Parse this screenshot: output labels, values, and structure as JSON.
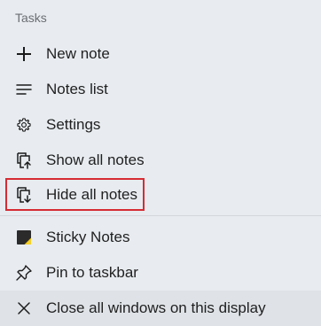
{
  "menu": {
    "section_label": "Tasks",
    "items": [
      {
        "label": "New note",
        "icon": "plus-icon"
      },
      {
        "label": "Notes list",
        "icon": "list-icon"
      },
      {
        "label": "Settings",
        "icon": "gear-icon"
      },
      {
        "label": "Show all notes",
        "icon": "show-notes-icon"
      },
      {
        "label": "Hide all notes",
        "icon": "hide-notes-icon"
      }
    ],
    "app_items": [
      {
        "label": "Sticky Notes",
        "icon": "sticky-notes-app-icon"
      },
      {
        "label": "Pin to taskbar",
        "icon": "pin-icon"
      },
      {
        "label": "Close all windows on this display",
        "icon": "close-icon"
      }
    ]
  },
  "colors": {
    "background": "#e8ecf0",
    "highlight_border": "#d62b33",
    "sticky_yellow": "#f5d12a",
    "sticky_dark": "#2b2b2b"
  }
}
